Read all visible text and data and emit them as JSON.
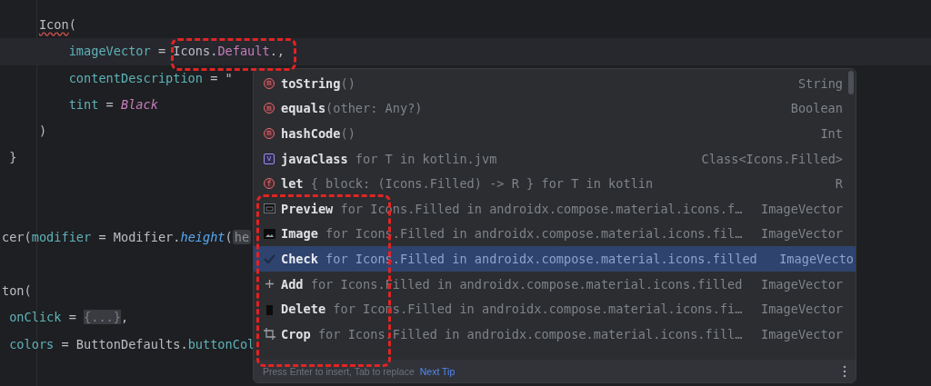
{
  "editor": {
    "lines": [
      {
        "kind": "code",
        "current": false,
        "tokens": [
          {
            "text": "     Icon",
            "kind": "error"
          },
          {
            "text": "(",
            "kind": "plain"
          }
        ]
      },
      {
        "kind": "code",
        "current": true,
        "tokens": [
          {
            "text": "         imageVector",
            "kind": "param"
          },
          {
            "text": " = Icons.",
            "kind": "plain"
          },
          {
            "text": "Default",
            "kind": "member"
          },
          {
            "text": ".,",
            "kind": "plain"
          }
        ]
      },
      {
        "kind": "code",
        "current": false,
        "tokens": [
          {
            "text": "         contentDescription",
            "kind": "param"
          },
          {
            "text": " = \"",
            "kind": "plain"
          }
        ]
      },
      {
        "kind": "code",
        "current": false,
        "tokens": [
          {
            "text": "         tint",
            "kind": "param"
          },
          {
            "text": " = ",
            "kind": "plain"
          },
          {
            "text": "Black",
            "kind": "constant"
          }
        ]
      },
      {
        "kind": "code",
        "current": false,
        "tokens": [
          {
            "text": "     )",
            "kind": "plain"
          }
        ]
      },
      {
        "kind": "code",
        "current": false,
        "tokens": [
          {
            "text": " }",
            "kind": "plain"
          }
        ]
      },
      {
        "kind": "blank"
      },
      {
        "kind": "blank"
      },
      {
        "kind": "code",
        "current": false,
        "tokens": [
          {
            "text": "cer(",
            "kind": "plain"
          },
          {
            "text": "modifier",
            "kind": "param"
          },
          {
            "text": " = Modifier.",
            "kind": "plain"
          },
          {
            "text": "height",
            "kind": "call"
          },
          {
            "text": "(",
            "kind": "plain"
          },
          {
            "text": "he",
            "kind": "hint"
          }
        ]
      },
      {
        "kind": "blank"
      },
      {
        "kind": "code",
        "current": false,
        "tokens": [
          {
            "text": "ton(",
            "kind": "plain"
          }
        ]
      },
      {
        "kind": "code",
        "current": false,
        "tokens": [
          {
            "text": " onClick",
            "kind": "param"
          },
          {
            "text": " = ",
            "kind": "plain"
          },
          {
            "text": "{...}",
            "kind": "folded"
          },
          {
            "text": ",",
            "kind": "plain"
          }
        ]
      },
      {
        "kind": "code",
        "current": false,
        "tokens": [
          {
            "text": " colors",
            "kind": "param"
          },
          {
            "text": " = ButtonDefaults.",
            "kind": "plain"
          },
          {
            "text": "buttonCol",
            "kind": "param"
          }
        ]
      }
    ]
  },
  "completion": {
    "items": [
      {
        "kind": "method",
        "badge": "m",
        "name": "toString",
        "detail": "()",
        "type": "String",
        "selected": false
      },
      {
        "kind": "method",
        "badge": "m",
        "name": "equals",
        "detail": "(other: Any?)",
        "type": "Boolean",
        "selected": false
      },
      {
        "kind": "method",
        "badge": "m",
        "name": "hashCode",
        "detail": "()",
        "type": "Int",
        "selected": false
      },
      {
        "kind": "property",
        "badge": "v",
        "name": "javaClass",
        "detail": " for T in kotlin.jvm",
        "type": "Class<Icons.Filled>",
        "selected": false
      },
      {
        "kind": "function",
        "badge": "f",
        "name": "let",
        "detail": " { block: (Icons.Filled) -> R } for T in kotlin",
        "type": "R",
        "selected": false
      },
      {
        "kind": "preview",
        "name": "Preview",
        "detail": " for Icons.Filled in androidx.compose.material.icons.f…",
        "type": "ImageVector",
        "selected": false
      },
      {
        "kind": "image",
        "name": "Image",
        "detail": " for Icons.Filled in androidx.compose.material.icons.fil…",
        "type": "ImageVector",
        "selected": false
      },
      {
        "kind": "check",
        "name": "Check",
        "detail": " for Icons.Filled in androidx.compose.material.icons.filled",
        "type": "ImageVecto",
        "selected": true
      },
      {
        "kind": "add",
        "name": "Add",
        "detail": " for Icons.Filled in androidx.compose.material.icons.filled",
        "type": "ImageVector",
        "selected": false
      },
      {
        "kind": "delete",
        "name": "Delete",
        "detail": " for Icons.Filled in androidx.compose.material.icons.fi…",
        "type": "ImageVector",
        "selected": false
      },
      {
        "kind": "crop",
        "name": "Crop",
        "detail": " for Icons.Filled in androidx.compose.material.icons.fill…",
        "type": "ImageVector",
        "selected": false
      }
    ],
    "footer": {
      "hint": "Press Enter to insert, Tab to replace",
      "link": "Next Tip"
    }
  }
}
